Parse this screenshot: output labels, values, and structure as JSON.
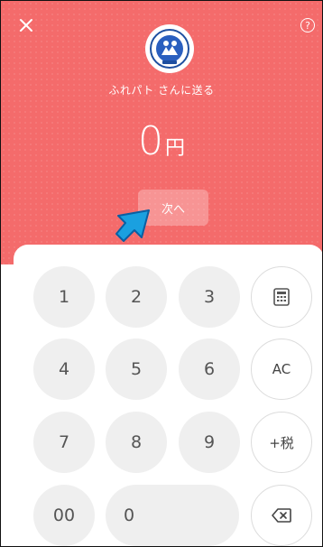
{
  "header": {
    "recipient": "ふれパト さんに送る",
    "amount": "0",
    "currency": "円",
    "next_label": "次へ",
    "help_label": "?",
    "background_color": "#f46b6b"
  },
  "keypad": {
    "keys": {
      "k1": "1",
      "k2": "2",
      "k3": "3",
      "k4": "4",
      "k5": "5",
      "k6": "6",
      "k7": "7",
      "k8": "8",
      "k9": "9",
      "k00": "00",
      "k0": "0",
      "ac": "AC",
      "tax": "+税"
    },
    "icons": {
      "calculator": "calculator-icon",
      "backspace": "backspace-icon"
    }
  }
}
